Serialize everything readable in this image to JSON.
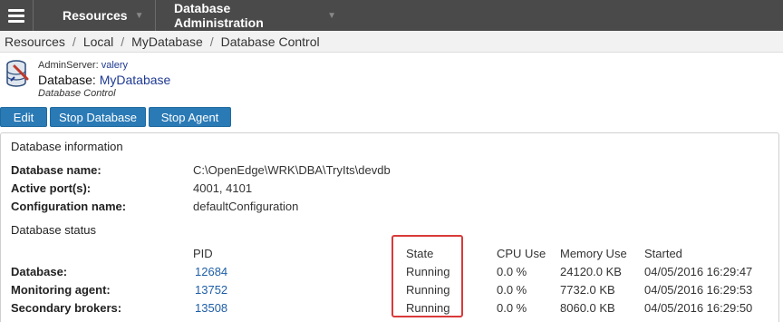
{
  "nav": {
    "items": [
      {
        "label": "Resources"
      },
      {
        "label": "Database Administration"
      }
    ]
  },
  "breadcrumb": [
    "Resources",
    "Local",
    "MyDatabase",
    "Database Control"
  ],
  "header": {
    "admin_server_label": "AdminServer:",
    "admin_server_value": "valery",
    "database_label": "Database:",
    "database_name": "MyDatabase",
    "subtitle": "Database Control"
  },
  "buttons": {
    "edit": "Edit",
    "stop_database": "Stop Database",
    "stop_agent": "Stop Agent"
  },
  "info": {
    "title": "Database information",
    "rows": [
      {
        "label": "Database name:",
        "value": "C:\\OpenEdge\\WRK\\DBA\\TryIts\\devdb"
      },
      {
        "label": "Active port(s):",
        "value": "4001, 4101"
      },
      {
        "label": "Configuration name:",
        "value": "defaultConfiguration"
      }
    ]
  },
  "status": {
    "title": "Database status",
    "columns": {
      "pid": "PID",
      "state": "State",
      "cpu": "CPU Use",
      "memory": "Memory Use",
      "started": "Started"
    },
    "rows": [
      {
        "label": "Database:",
        "pid": "12684",
        "state": "Running",
        "cpu": "0.0 %",
        "memory": "24120.0 KB",
        "started": "04/05/2016 16:29:47"
      },
      {
        "label": "Monitoring agent:",
        "pid": "13752",
        "state": "Running",
        "cpu": "0.0 %",
        "memory": "7732.0 KB",
        "started": "04/05/2016 16:29:53"
      },
      {
        "label": "Secondary brokers:",
        "pid": "13508",
        "state": "Running",
        "cpu": "0.0 %",
        "memory": "8060.0 KB",
        "started": "04/05/2016 16:29:50"
      }
    ]
  },
  "colors": {
    "nav_bg": "#4a4a4a",
    "button_bg": "#2a7ab6",
    "link": "#1f5fa6",
    "highlight_border": "#d93a3a"
  }
}
